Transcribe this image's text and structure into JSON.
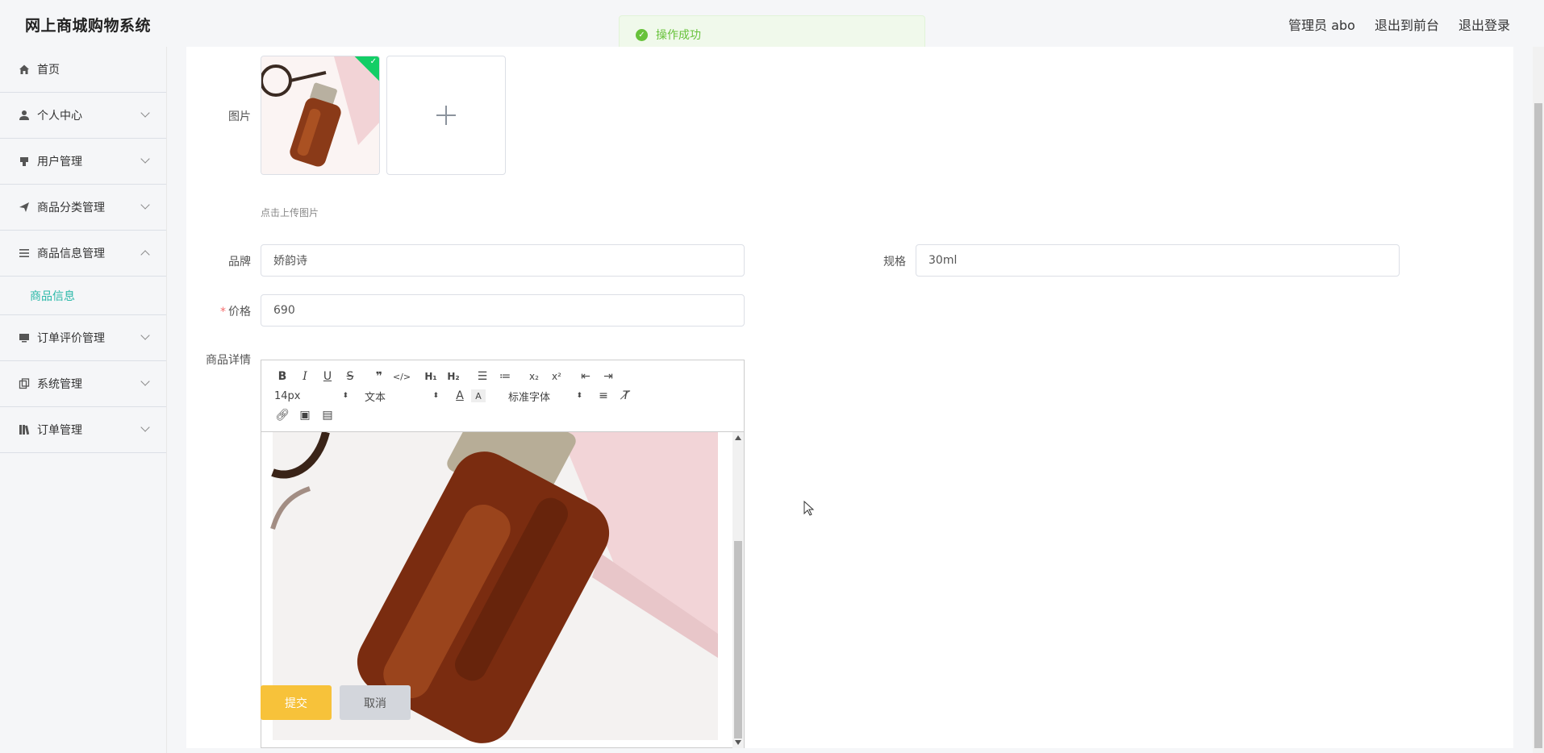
{
  "header": {
    "app_title": "网上商城购物系统",
    "admin": "管理员 abo",
    "to_front": "退出到前台",
    "logout": "退出登录"
  },
  "toast": {
    "message": "操作成功"
  },
  "sidebar": {
    "items": [
      {
        "label": "首页",
        "icon": "home-icon"
      },
      {
        "label": "个人中心",
        "icon": "user-icon"
      },
      {
        "label": "用户管理",
        "icon": "user-manage-icon"
      },
      {
        "label": "商品分类管理",
        "icon": "send-icon"
      },
      {
        "label": "商品信息管理",
        "icon": "list-icon",
        "expanded": true
      },
      {
        "label": "订单评价管理",
        "icon": "monitor-icon"
      },
      {
        "label": "系统管理",
        "icon": "copy-icon"
      },
      {
        "label": "订单管理",
        "icon": "book-icon"
      }
    ],
    "sub_item": "商品信息"
  },
  "form": {
    "image_label": "图片",
    "upload_tip": "点击上传图片",
    "brand_label": "品牌",
    "brand_value": "娇韵诗",
    "spec_label": "规格",
    "spec_value": "30ml",
    "price_label": "价格",
    "price_value": "690",
    "detail_label": "商品详情"
  },
  "editor": {
    "font_size": "14px",
    "header_select": "文本",
    "font_family": "标准字体"
  },
  "buttons": {
    "submit": "提交",
    "cancel": "取消"
  },
  "colors": {
    "accent": "#2ab8a8",
    "submit": "#f7c23a",
    "success": "#67c23a"
  }
}
